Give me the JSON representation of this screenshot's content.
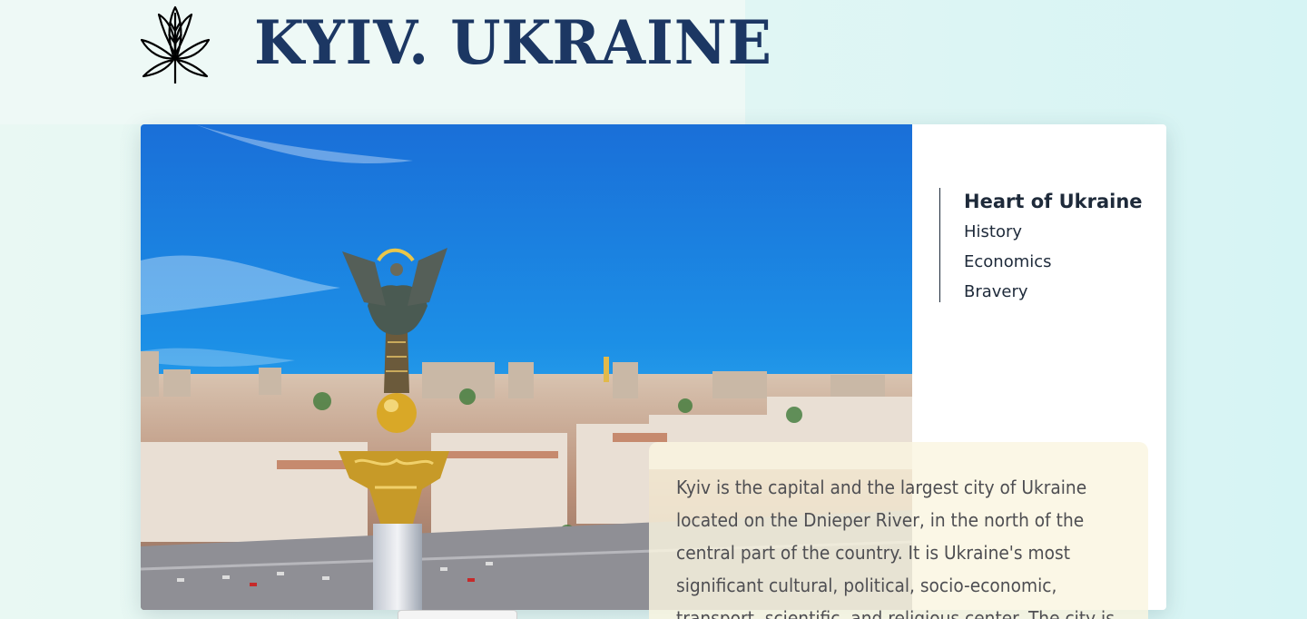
{
  "header": {
    "title": "KYIV. UKRAINE",
    "logo_icon": "chestnut-leaf-icon"
  },
  "hero": {
    "image_icon": "independence-monument-photo"
  },
  "nav": {
    "items": [
      {
        "label": "Heart of Ukraine",
        "active": true
      },
      {
        "label": "History",
        "active": false
      },
      {
        "label": "Economics",
        "active": false
      },
      {
        "label": "Bravery",
        "active": false
      }
    ]
  },
  "info": {
    "text": "Kyiv is the capital and the largest city of Ukraine located on the Dnieper River, in the north of the central part of the country. It is Ukraine's most significant cultural, political, socio-economic, transport, scientific, and religious center. The city is"
  },
  "colors": {
    "title": "#1c3763",
    "nav_text": "#1e2a3a",
    "info_bg": "#faf5e0",
    "page_bg": "#e2f6f4"
  }
}
